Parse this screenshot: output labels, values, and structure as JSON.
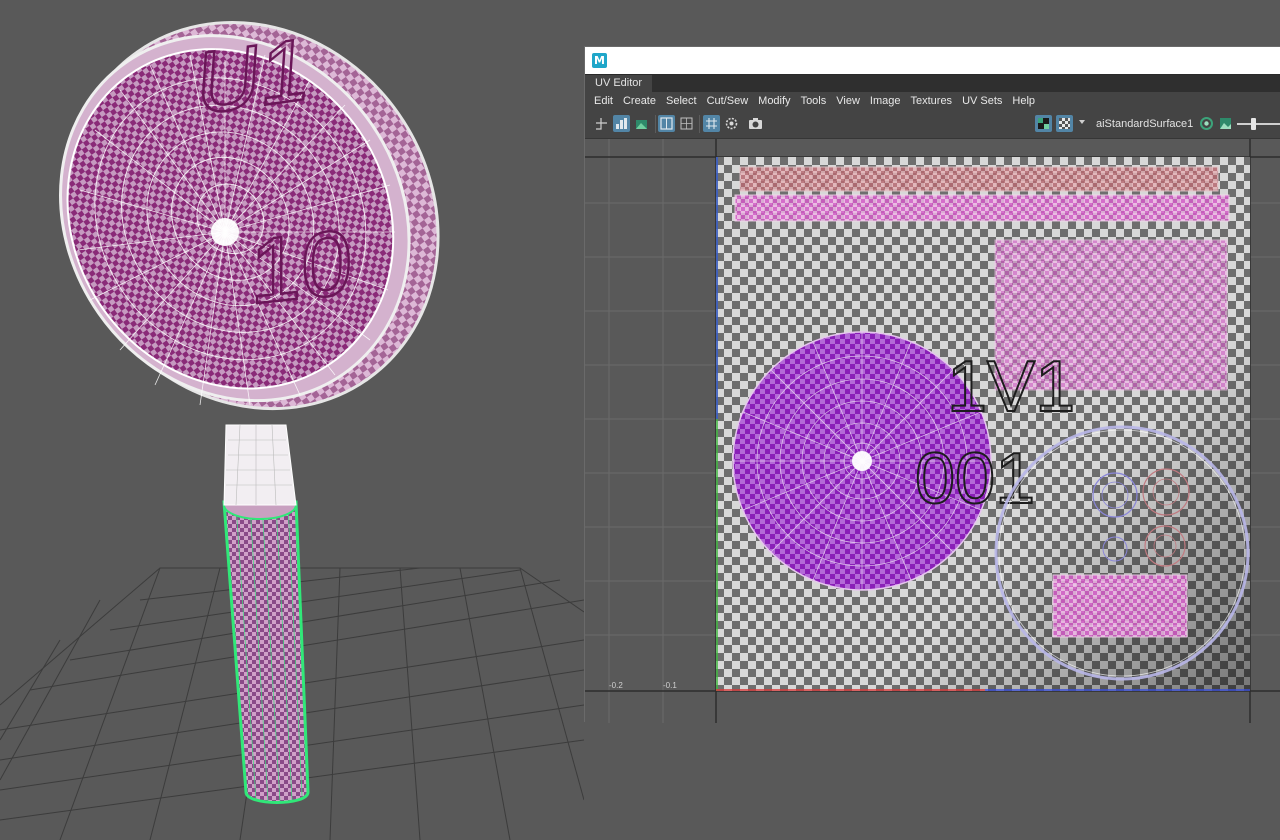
{
  "uv_editor": {
    "tab_label": "UV Editor",
    "menu": [
      "Edit",
      "Create",
      "Select",
      "Cut/Sew",
      "Modify",
      "Tools",
      "View",
      "Image",
      "Textures",
      "UV Sets",
      "Help"
    ],
    "shader_name": "aiStandardSurface1",
    "axis_labels": [
      "-0.2",
      "-0.1"
    ],
    "tile_label_1": "1V1",
    "tile_label_2": "001"
  },
  "viewport": {
    "texture_label_1": "U1",
    "texture_label_2": "10"
  },
  "colors": {
    "checker_magenta": "#a04c8c",
    "uv_purple": "#9b2fc4",
    "selection_green": "#30e878",
    "shell_pink": "#e070d0",
    "shell_red": "#c07a80",
    "tool_active": "#5285a6",
    "grid_line": "#7a7a7a",
    "background": "#595959"
  },
  "icons": [
    "maya-logo-icon",
    "uv-toolkit-icons",
    "checker-display-icon",
    "image-display-icon",
    "shader-color-icon"
  ]
}
